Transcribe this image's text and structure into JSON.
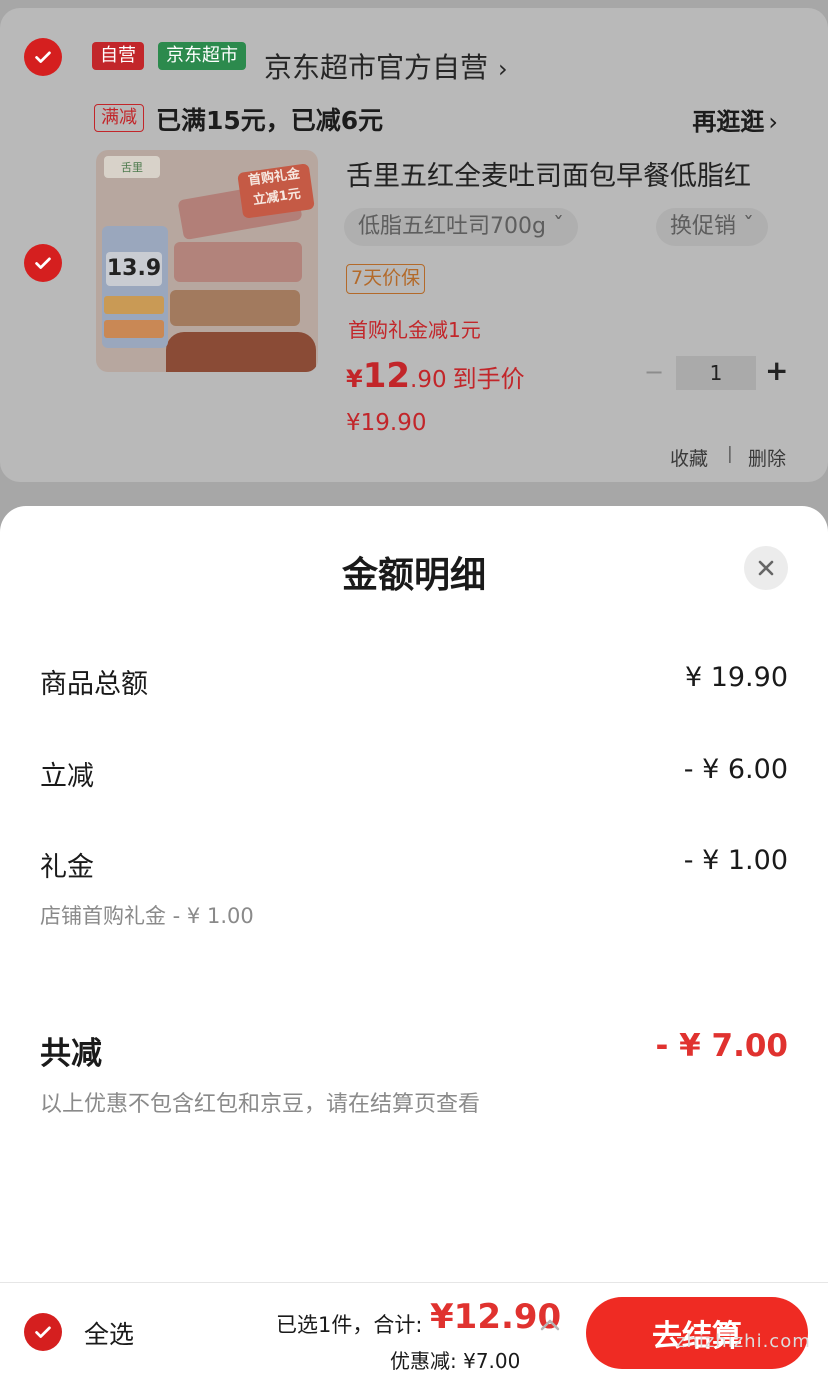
{
  "cart": {
    "tag_self": "自营",
    "tag_market": "京东超市",
    "shop_name": "京东超市官方自营",
    "shop_arrow": "›",
    "promo_tag": "满减",
    "promo_text": "已满15元，已减6元",
    "more_link": "再逛逛",
    "more_arrow": "›",
    "product": {
      "image_brand": "舌里",
      "image_price": "13.9",
      "image_badge_1": "首购礼金",
      "image_badge_2": "立减1元",
      "title": "舌里五红全麦吐司面包早餐低脂红",
      "spec": "低脂五红吐司700g ˇ",
      "swap_promo": "换促销 ˇ",
      "guarantee": "7天价保",
      "gift": "首购礼金减1元",
      "hand_currency": "¥",
      "hand_price_int": "12",
      "hand_price_dec": ".90",
      "hand_label": "到手价",
      "original_price": "¥19.90",
      "minus": "−",
      "quantity": "1",
      "plus": "+",
      "favorite": "收藏",
      "separator": "|",
      "delete": "删除"
    }
  },
  "sheet": {
    "title": "金额明细",
    "rows": [
      {
        "label": "商品总额",
        "value": "¥ 19.90"
      },
      {
        "label": "立减",
        "value": "- ¥ 6.00"
      },
      {
        "label": "礼金",
        "value": "- ¥ 1.00"
      }
    ],
    "gift_detail": "店铺首购礼金 - ¥ 1.00",
    "total_label": "共减",
    "total_value": "- ¥ 7.00",
    "note": "以上优惠不包含红包和京豆，请在结算页查看"
  },
  "bottombar": {
    "select_all": "全选",
    "selected_text": "已选1件，合计:",
    "total_price": "¥12.90",
    "discount_text": "优惠减:  ¥7.00",
    "checkout": "去结算",
    "watermark": "zhizhizhi.com"
  },
  "colors": {
    "accent_red": "#e0322f",
    "checkbox_red": "#d51f1f",
    "market_green": "#2c8a4d"
  }
}
